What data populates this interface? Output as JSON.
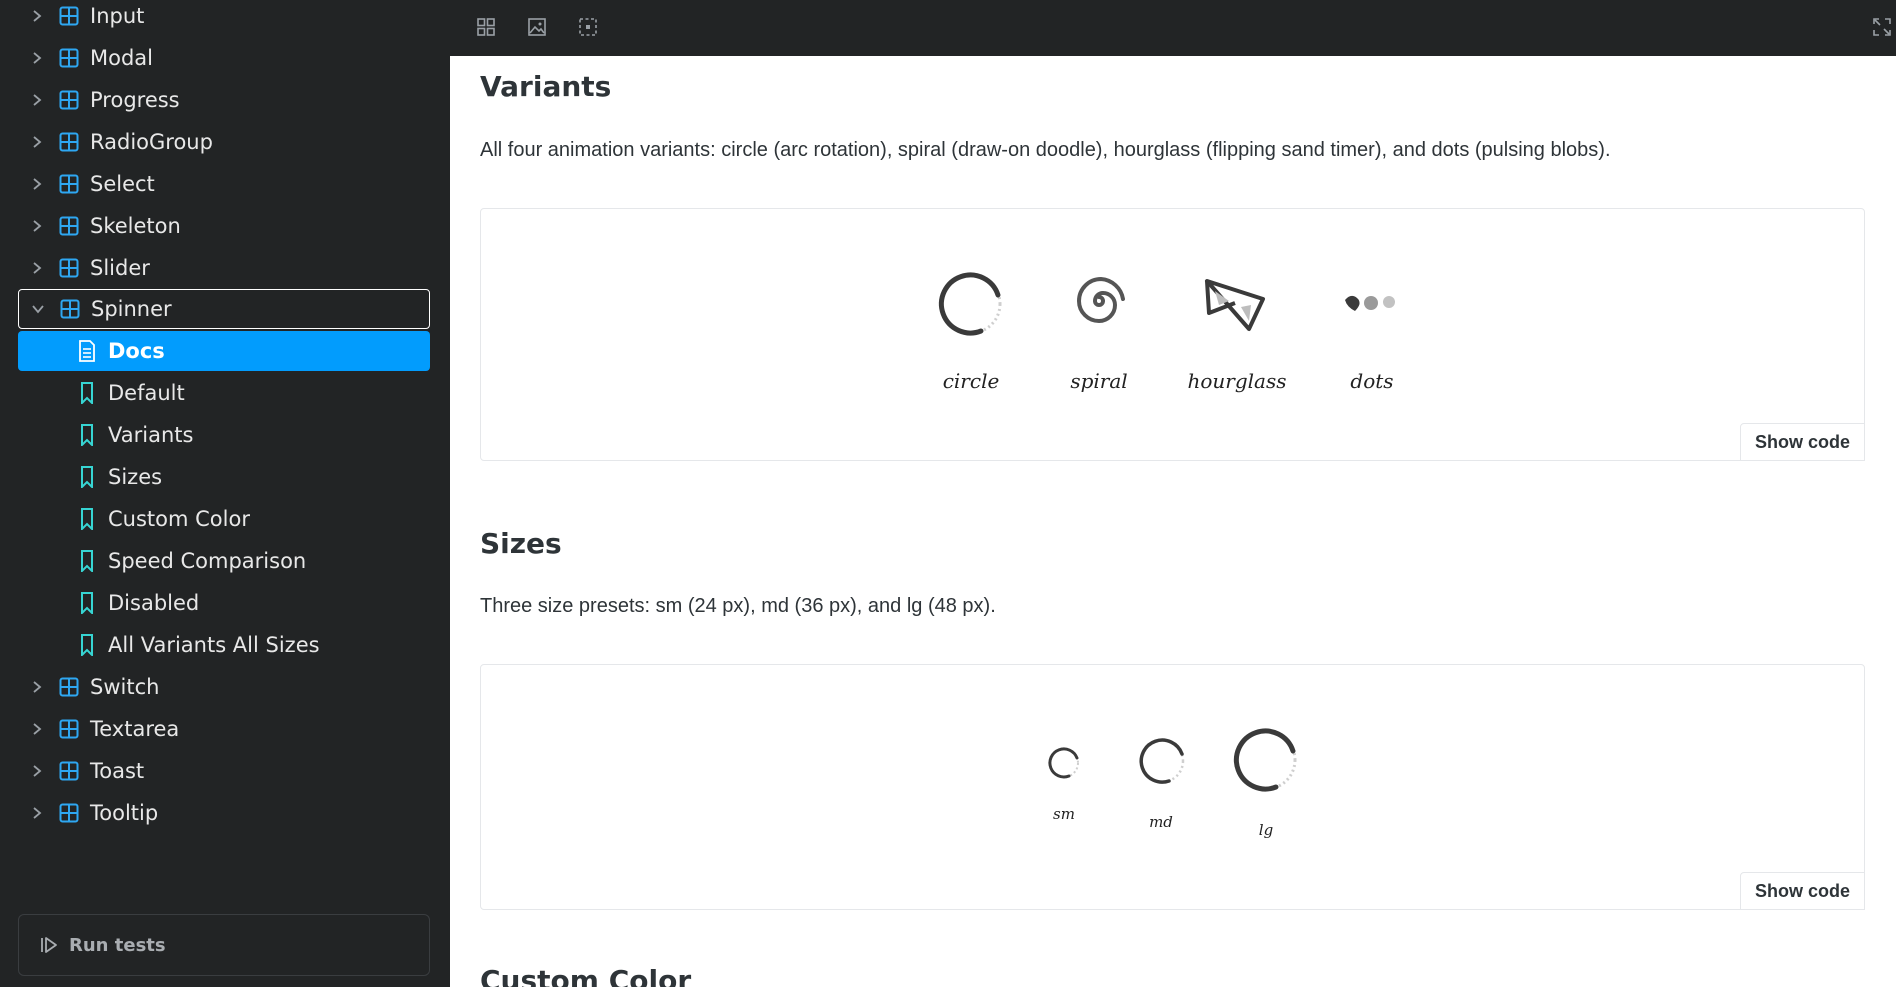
{
  "sidebar": {
    "items": [
      {
        "label": "Input"
      },
      {
        "label": "Modal"
      },
      {
        "label": "Progress"
      },
      {
        "label": "RadioGroup"
      },
      {
        "label": "Select"
      },
      {
        "label": "Skeleton"
      },
      {
        "label": "Slider"
      },
      {
        "label": "Spinner",
        "expanded": true
      },
      {
        "label": "Docs",
        "selected": true
      },
      {
        "label": "Default"
      },
      {
        "label": "Variants"
      },
      {
        "label": "Sizes"
      },
      {
        "label": "Custom Color"
      },
      {
        "label": "Speed Comparison"
      },
      {
        "label": "Disabled"
      },
      {
        "label": "All Variants All Sizes"
      },
      {
        "label": "Switch"
      },
      {
        "label": "Textarea"
      },
      {
        "label": "Toast"
      },
      {
        "label": "Tooltip"
      }
    ],
    "run_tests_label": "Run tests"
  },
  "toolbar": {
    "icons": [
      "grid-icon",
      "image-icon",
      "outline-icon",
      "fullscreen-icon"
    ]
  },
  "main": {
    "variants": {
      "heading": "Variants",
      "description": "All four animation variants: circle (arc rotation), spiral (draw-on doodle), hourglass (flipping sand timer), and dots (pulsing blobs).",
      "labels": [
        "circle",
        "spiral",
        "hourglass",
        "dots"
      ],
      "show_code": "Show code"
    },
    "sizes": {
      "heading": "Sizes",
      "description": "Three size presets: sm (24 px), md (36 px), and lg (48 px).",
      "labels": [
        "sm",
        "md",
        "lg"
      ],
      "show_code": "Show code"
    },
    "next_heading": "Custom Color"
  },
  "colors": {
    "sidebar_bg": "#222425",
    "accent": "#029cfd",
    "icon_blue": "#2ea7f2",
    "bookmark_teal": "#37d5d3"
  }
}
